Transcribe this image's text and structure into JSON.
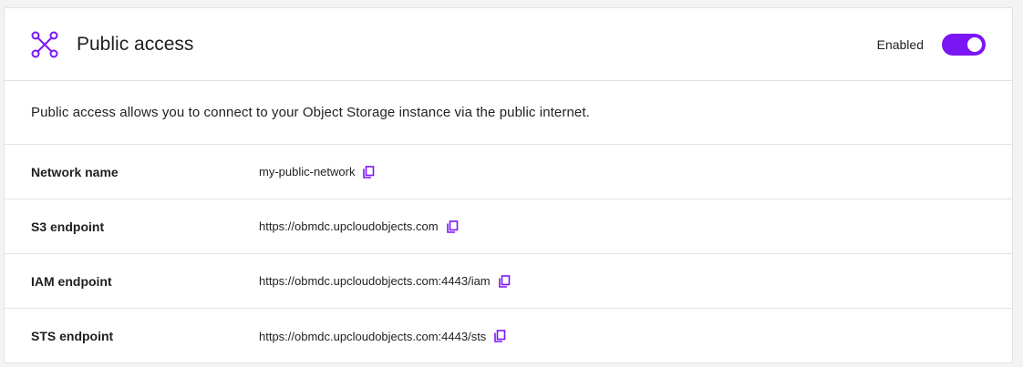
{
  "panel": {
    "title": "Public access",
    "icon": "network-nodes-icon",
    "toggle_label": "Enabled",
    "toggle_on": true,
    "accent_color": "#7b16f5"
  },
  "description": "Public access allows you to connect to your Object Storage instance via the public internet.",
  "rows": [
    {
      "label": "Network name",
      "value": "my-public-network",
      "icon": "copy-icon"
    },
    {
      "label": "S3 endpoint",
      "value": "https://obmdc.upcloudobjects.com",
      "icon": "copy-icon"
    },
    {
      "label": "IAM endpoint",
      "value": "https://obmdc.upcloudobjects.com:4443/iam",
      "icon": "copy-icon"
    },
    {
      "label": "STS endpoint",
      "value": "https://obmdc.upcloudobjects.com:4443/sts",
      "icon": "copy-icon"
    }
  ]
}
